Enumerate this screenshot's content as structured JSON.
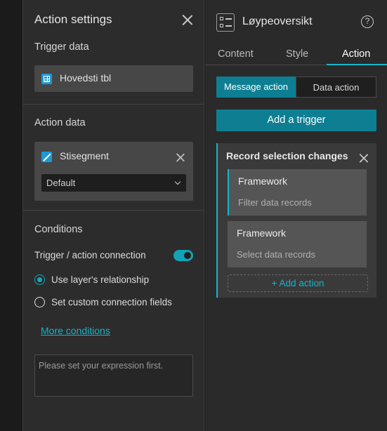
{
  "action_settings": {
    "title": "Action settings",
    "trigger_data_label": "Trigger data",
    "trigger_data_value": "Hovedsti tbl",
    "action_data_label": "Action data",
    "action_data_value": "Stisegment",
    "action_data_select": "Default",
    "conditions_label": "Conditions",
    "connection_label": "Trigger / action connection",
    "connection_enabled": true,
    "radio_relationship": "Use layer's relationship",
    "radio_custom": "Set custom connection fields",
    "selected_radio": "relationship",
    "more_conditions": "More conditions",
    "expression_placeholder": "Please set your expression first."
  },
  "widget": {
    "title": "Løypeoversikt",
    "help_glyph": "?",
    "tabs": [
      {
        "label": "Content"
      },
      {
        "label": "Style"
      },
      {
        "label": "Action"
      }
    ],
    "active_tab": "Action",
    "segments": [
      {
        "label": "Message action"
      },
      {
        "label": "Data action"
      }
    ],
    "active_segment": "Message action",
    "add_trigger": "Add a trigger",
    "trigger": {
      "title": "Record selection changes",
      "actions": [
        {
          "name": "Framework",
          "description": "Filter data records"
        },
        {
          "name": "Framework",
          "description": "Select data records"
        }
      ],
      "add_action": "+ Add action"
    }
  },
  "colors": {
    "accent": "#19b4ca",
    "accent_dark": "#0e7f92",
    "panel_bg": "#2c2c2c"
  }
}
